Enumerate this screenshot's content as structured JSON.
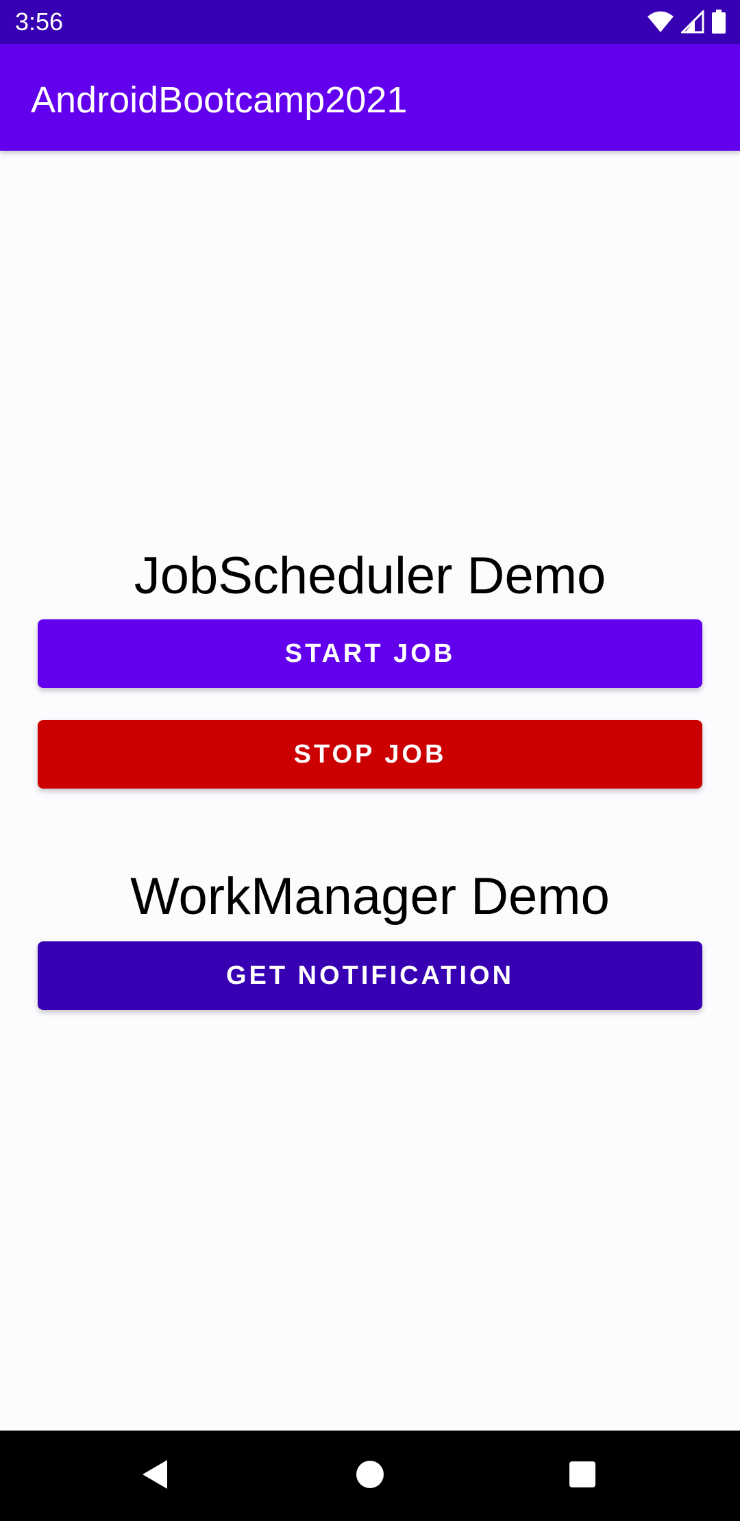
{
  "status_bar": {
    "time": "3:56",
    "icons": [
      "wifi-icon",
      "signal-icon",
      "battery-icon"
    ]
  },
  "app_bar": {
    "title": "AndroidBootcamp2021"
  },
  "job_section": {
    "heading": "JobScheduler Demo",
    "start_label": "START JOB",
    "stop_label": "STOP JOB"
  },
  "work_section": {
    "heading": "WorkManager Demo",
    "notify_label": "GET NOTIFICATION"
  },
  "nav_bar": {
    "icons": [
      "back-icon",
      "home-icon",
      "recents-icon"
    ]
  },
  "colors": {
    "status_bar": "#3700b3",
    "app_bar": "#6200ee",
    "start_button": "#6200ee",
    "stop_button": "#cc0000",
    "notify_button": "#3700b3",
    "background": "#fcfbfe"
  }
}
